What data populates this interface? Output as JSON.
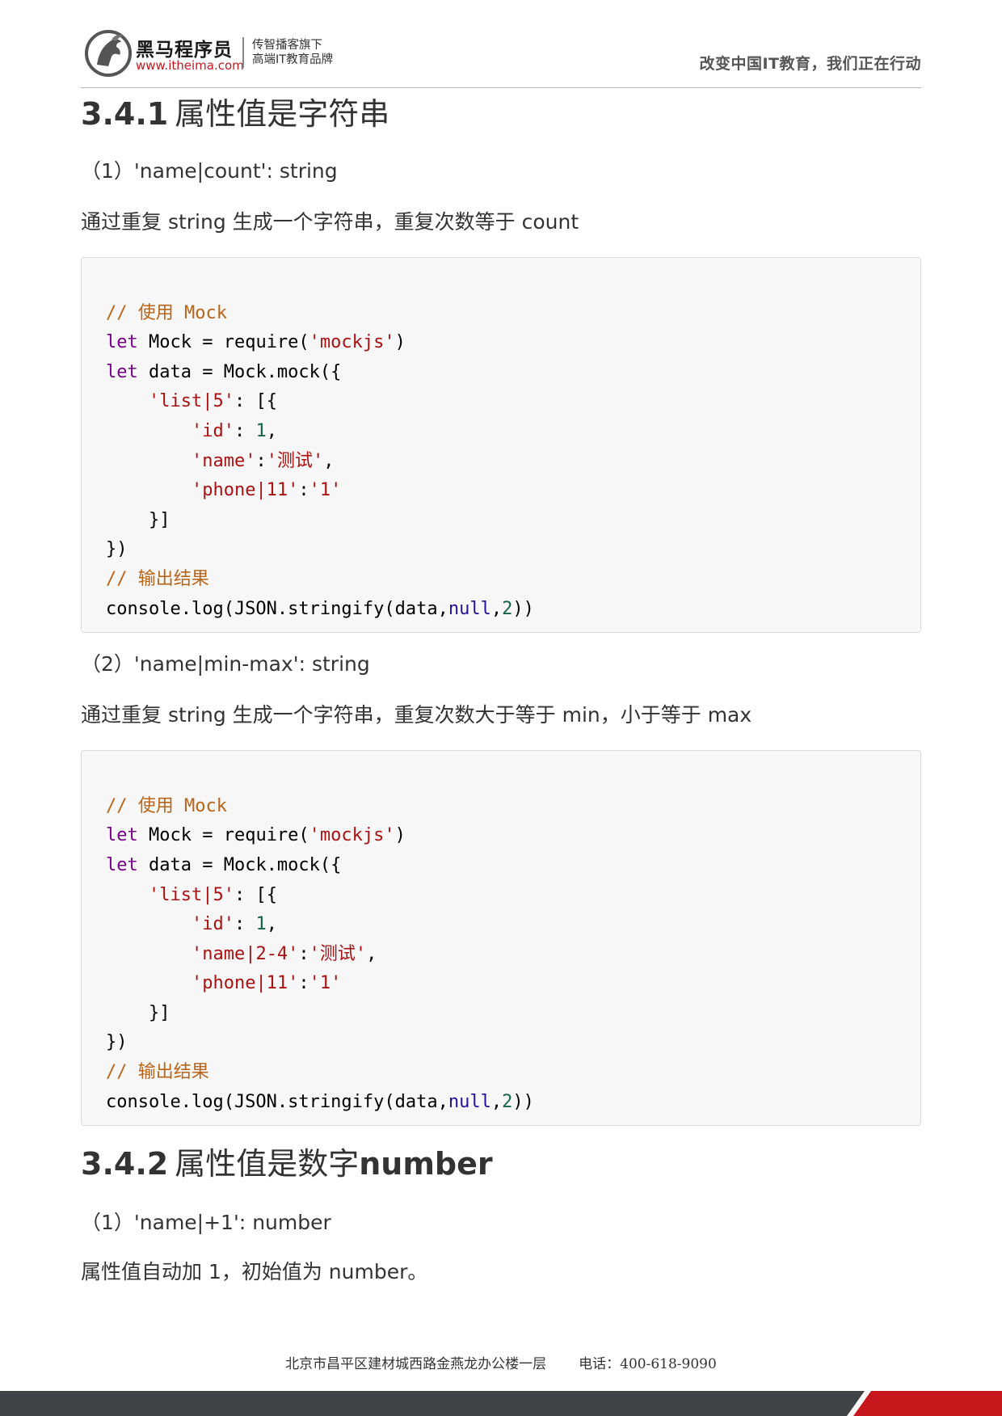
{
  "header": {
    "brand_name": "黑马程序员",
    "brand_url": "www.itheima.com",
    "tagline_1": "传智播客旗下",
    "tagline_2": "高端IT教育品牌",
    "slogan": "改变中国IT教育，我们正在行动"
  },
  "section1": {
    "num": "3.4.1",
    "title": "属性值是字符串",
    "item1": "（1）'name|count': string",
    "desc1": "通过重复 string 生成一个字符串，重复次数等于 count",
    "item2": "（2）'name|min-max': string",
    "desc2": "通过重复 string 生成一个字符串，重复次数大于等于 min，小于等于 max"
  },
  "code1": {
    "comment1": "// 使用 Mock",
    "kw_let": "let",
    "l2_mid": " Mock = require(",
    "l2_str": "'mockjs'",
    "l2_end": ")",
    "l3_mid": " data = Mock.mock({",
    "l4_str": "'list|5'",
    "l4_end": ": [{",
    "l5_key": "'id'",
    "l5_sep": ": ",
    "l5_num": "1",
    "l5_end": ",",
    "l6_key": "'name'",
    "l6_sep": ":",
    "l6_val": "'测试'",
    "l6_end": ",",
    "l7_key": "'phone|11'",
    "l7_sep": ":",
    "l7_val": "'1'",
    "l8": "}]",
    "l9": "})",
    "comment2": "// 输出结果",
    "l11_a": "console.log(JSON.stringify(data,",
    "l11_null": "null",
    "l11_b": ",",
    "l11_num": "2",
    "l11_end": "))"
  },
  "code2": {
    "l6_key": "'name|2-4'"
  },
  "section2": {
    "num": "3.4.2",
    "title_a": "属性值是数字",
    "title_b": "number",
    "item1": "（1）'name|+1': number",
    "desc1": "属性值自动加 1，初始值为 number。"
  },
  "footer": {
    "address": "北京市昌平区建材城西路金燕龙办公楼一层",
    "phone": "电话：400-618-9090"
  },
  "colors": {
    "footer_dark": "#3d4347",
    "footer_red": "#c8161d",
    "brand_red": "#c8161d"
  }
}
